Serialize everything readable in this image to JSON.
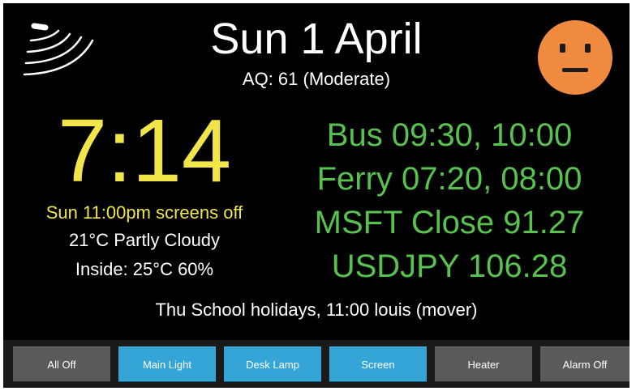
{
  "header": {
    "date": "Sun 1 April",
    "air_quality": "AQ: 61 (Moderate)",
    "status_icon": "wifi-signal-icon",
    "mood_icon": "neutral-face-icon",
    "mood_color": "#f08a3e"
  },
  "left_panel": {
    "time": "7:14",
    "screen_schedule": "Sun 11:00pm screens off",
    "weather": "21°C Partly Cloudy",
    "inside": "Inside: 25°C 60%"
  },
  "right_panel": {
    "lines": [
      "Bus 09:30, 10:00",
      "Ferry 07:20, 08:00",
      "MSFT Close 91.27",
      "USDJPY 106.28"
    ]
  },
  "events": "Thu School holidays,  11:00 louis (mover)",
  "buttons": [
    {
      "label": "All Off",
      "state": "off"
    },
    {
      "label": "Main Light",
      "state": "on"
    },
    {
      "label": "Desk Lamp",
      "state": "on"
    },
    {
      "label": "Screen",
      "state": "on"
    },
    {
      "label": "Heater",
      "state": "off"
    },
    {
      "label": "Alarm Off",
      "state": "off"
    }
  ],
  "colors": {
    "background": "#000000",
    "clock_yellow": "#f1e54a",
    "info_green": "#58c24e",
    "button_active": "#35a5d8",
    "button_inactive": "#5a5a5a"
  }
}
